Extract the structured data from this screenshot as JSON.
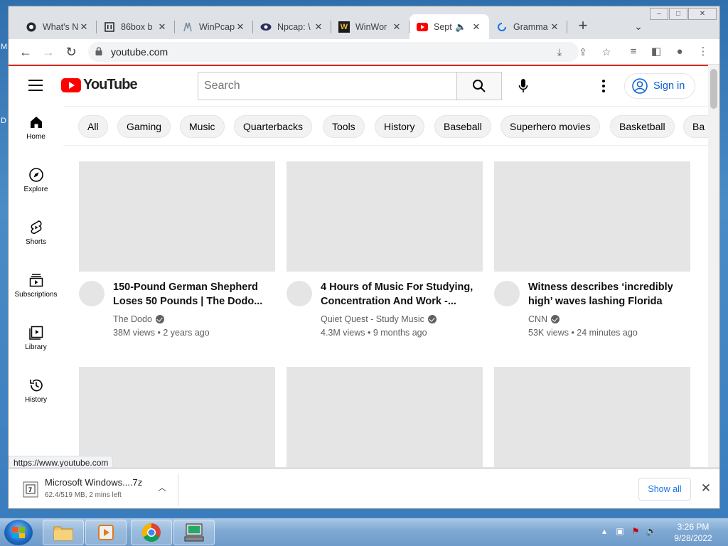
{
  "browser": {
    "tabs": [
      {
        "title": "What's N",
        "favicon": "github-icon"
      },
      {
        "title": "86box b",
        "favicon": "bank-icon"
      },
      {
        "title": "WinPcap",
        "favicon": "winpcap-icon"
      },
      {
        "title": "Npcap: \\",
        "favicon": "npcap-eye-icon"
      },
      {
        "title": "WinWor",
        "favicon": "winworld-icon"
      },
      {
        "title": "Sept",
        "favicon": "youtube-icon",
        "active": true,
        "audio": "speaker-icon"
      },
      {
        "title": "Gramma",
        "favicon": "loading-icon"
      }
    ],
    "address": "youtube.com",
    "status_url": "https://www.youtube.com"
  },
  "youtube": {
    "logo_text": "YouTube",
    "search_placeholder": "Search",
    "signin_label": "Sign in",
    "brand_color": "#ff0000",
    "chips": [
      "All",
      "Gaming",
      "Music",
      "Quarterbacks",
      "Tools",
      "History",
      "Baseball",
      "Superhero movies",
      "Basketball",
      "Ba"
    ],
    "guide": [
      {
        "label": "Home",
        "icon": "home-icon"
      },
      {
        "label": "Explore",
        "icon": "compass-icon"
      },
      {
        "label": "Shorts",
        "icon": "shorts-icon"
      },
      {
        "label": "Subscriptions",
        "icon": "subscriptions-icon"
      },
      {
        "label": "Library",
        "icon": "library-icon"
      },
      {
        "label": "History",
        "icon": "history-icon"
      }
    ],
    "videos": [
      {
        "title": "150-Pound German Shepherd Loses 50 Pounds | The Dodo...",
        "channel": "The Dodo",
        "stats": "38M views • 2 years ago"
      },
      {
        "title": "4 Hours of Music For Studying, Concentration And Work -...",
        "channel": "Quiet Quest - Study Music",
        "stats": "4.3M views • 9 months ago"
      },
      {
        "title": "Witness describes ‘incredibly high’ waves lashing Florida",
        "channel": "CNN",
        "stats": "53K views • 24 minutes ago"
      }
    ]
  },
  "download": {
    "filename": "Microsoft Windows....7z",
    "status": "62.4/519 MB, 2 mins left",
    "show_all_label": "Show all"
  },
  "taskbar": {
    "time": "3:26 PM",
    "date": "9/28/2022"
  }
}
